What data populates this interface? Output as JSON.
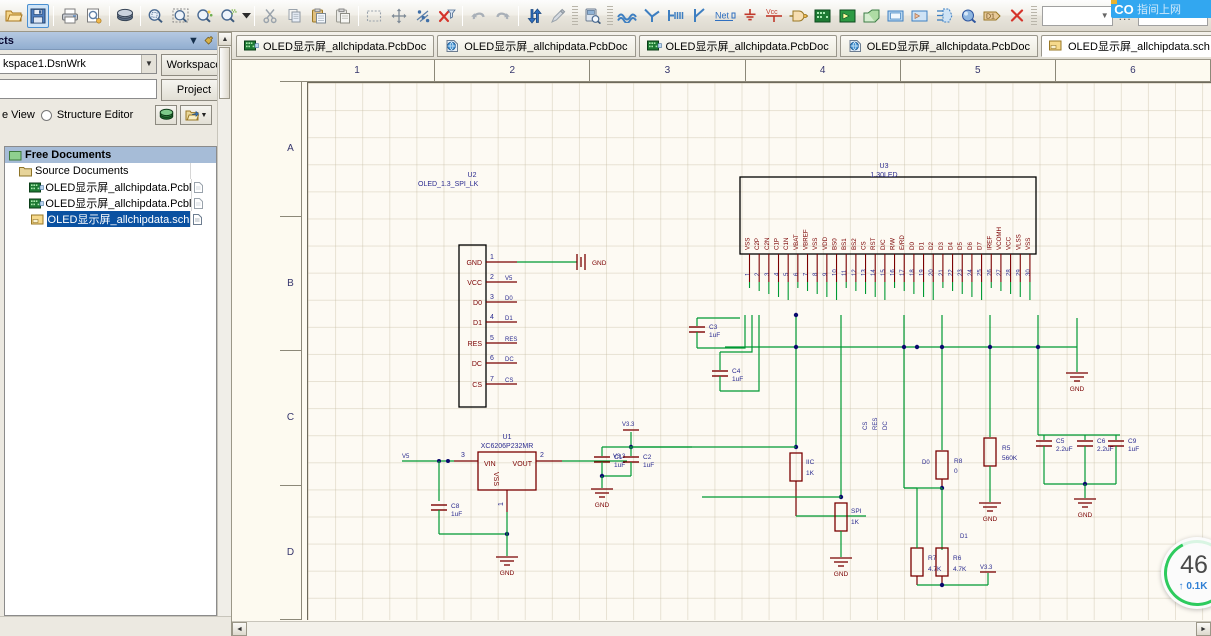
{
  "toolbar": {
    "buttons": [
      {
        "name": "open-icon",
        "label": "Open"
      },
      {
        "name": "save-icon",
        "label": "Save",
        "active": true
      },
      {
        "name": "print-icon",
        "label": "Print"
      },
      {
        "name": "print-preview-icon",
        "label": "Print Preview"
      },
      {
        "name": "board-insight-icon",
        "label": "Board Insight"
      },
      {
        "name": "zoom-area-icon",
        "label": "Zoom Area"
      },
      {
        "name": "zoom-selection-icon",
        "label": "Zoom Selection"
      },
      {
        "name": "zoom-filter-icon",
        "label": "Zoom Filter"
      },
      {
        "name": "zoom-mask-icon",
        "label": "Zoom Mask"
      },
      {
        "name": "cut-icon",
        "label": "Cut"
      },
      {
        "name": "copy-icon",
        "label": "Copy"
      },
      {
        "name": "paste-icon",
        "label": "Paste"
      },
      {
        "name": "paste-special-icon",
        "label": "Paste Special"
      },
      {
        "name": "select-area-icon",
        "label": "Select Area"
      },
      {
        "name": "move-icon",
        "label": "Move"
      },
      {
        "name": "deselect-icon",
        "label": "Deselect"
      },
      {
        "name": "clear-filter-icon",
        "label": "Clear Filter"
      },
      {
        "name": "undo-icon",
        "label": "Undo"
      },
      {
        "name": "redo-icon",
        "label": "Redo"
      },
      {
        "name": "updown-icon",
        "label": "Cross Probe"
      },
      {
        "name": "wand-icon",
        "label": "Smart Paste"
      },
      {
        "name": "browse-library-icon",
        "label": "Browse Library"
      },
      {
        "name": "place-wire-icon",
        "label": "Place Wire"
      },
      {
        "name": "place-bus-icon",
        "label": "Place Bus"
      },
      {
        "name": "place-signal-harness-icon",
        "label": "Place Signal Harness"
      },
      {
        "name": "place-bus-entry-icon",
        "label": "Place Bus Entry"
      },
      {
        "name": "place-net-label-icon",
        "label": "Place Net Label"
      },
      {
        "name": "place-gnd-icon",
        "label": "Place GND Power Port"
      },
      {
        "name": "place-vcc-icon",
        "label": "Place VCC Power Port"
      },
      {
        "name": "place-part-icon",
        "label": "Place Part"
      },
      {
        "name": "place-sheet-symbol-icon",
        "label": "Place Sheet Symbol"
      },
      {
        "name": "place-sheet-entry-icon",
        "label": "Place Sheet Entry"
      },
      {
        "name": "place-device-sheet-icon",
        "label": "Place Device Sheet Symbol"
      },
      {
        "name": "place-harness-connector-icon",
        "label": "Place Harness Connector"
      },
      {
        "name": "place-harness-entry-icon",
        "label": "Place Harness Entry"
      },
      {
        "name": "place-port-icon",
        "label": "Place Port"
      },
      {
        "name": "place-no-erc-icon",
        "label": "Place No ERC"
      }
    ],
    "combo1_value": "",
    "combo2_value": "",
    "ellipsis": "..."
  },
  "blue_overlay": {
    "badge": "CO",
    "text": "指间上网"
  },
  "projects_panel": {
    "title": "cts",
    "pin_icon": "pin-icon",
    "close_icon": "close-icon",
    "dropdown_icon": "chevron-down-icon",
    "workspace_value": "kspace1.DsnWrk",
    "workspace_button": "Workspace",
    "project_button": "Project",
    "project_value": "",
    "view_mode_label": "e View",
    "structure_editor_label": "Structure Editor",
    "globe_icon": "globe-icon",
    "open_doc_icon": "open-document-icon",
    "tree": [
      {
        "level": 0,
        "icon": "folder-green-icon",
        "label": "Free Documents",
        "selected_header": true,
        "page": ""
      },
      {
        "level": 1,
        "icon": "folder-icon",
        "label": "Source Documents",
        "page": ""
      },
      {
        "level": 2,
        "icon": "pcb-icon",
        "label": "OLED显示屏_allchipdata.Pcbl",
        "page": "doc-page-icon"
      },
      {
        "level": 2,
        "icon": "pcb-icon",
        "label": "OLED显示屏_allchipdata.Pcbl",
        "page": "doc-page-icon"
      },
      {
        "level": 2,
        "icon": "sch-icon",
        "label": "OLED显示屏_allchipdata.sch",
        "selected": true,
        "page": "doc-page-icon"
      }
    ]
  },
  "document_tabs": [
    {
      "icon": "pcb-icon",
      "label": "OLED显示屏_allchipdata.PcbDoc",
      "active": false
    },
    {
      "icon": "pcb3d-icon",
      "label": "OLED显示屏_allchipdata.PcbDoc",
      "active": false
    },
    {
      "icon": "pcb-icon",
      "label": "OLED显示屏_allchipdata.PcbDoc",
      "active": false
    },
    {
      "icon": "pcb3d-icon",
      "label": "OLED显示屏_allchipdata.PcbDoc",
      "active": false
    },
    {
      "icon": "sch-icon",
      "label": "OLED显示屏_allchipdata.sch",
      "active": true
    }
  ],
  "sheet": {
    "h_ruler": [
      "1",
      "2",
      "3",
      "4",
      "5",
      "6"
    ],
    "v_ruler": [
      "A",
      "B",
      "C",
      "D"
    ]
  },
  "schematic": {
    "components": [
      {
        "ref": "U2",
        "value": "OLED_1.3_SPI_LK",
        "pins": [
          {
            "num": "1",
            "name": "GND",
            "net": ""
          },
          {
            "num": "2",
            "name": "VCC",
            "net": "V5"
          },
          {
            "num": "3",
            "name": "D0",
            "net": "D0"
          },
          {
            "num": "4",
            "name": "D1",
            "net": "D1"
          },
          {
            "num": "5",
            "name": "RES",
            "net": "RES"
          },
          {
            "num": "6",
            "name": "DC",
            "net": "DC"
          },
          {
            "num": "7",
            "name": "CS",
            "net": "CS"
          }
        ],
        "gnd_label": "GND"
      },
      {
        "ref": "U3",
        "value": "1.30LED",
        "pin_names": [
          "VSS",
          "C2P",
          "C2N",
          "C1P",
          "C1N",
          "VBAT",
          "VBREF",
          "VSS",
          "VDD",
          "BS0",
          "BS1",
          "BS2",
          "CS",
          "RST",
          "D/C",
          "R/W",
          "E/RD",
          "D0",
          "D1",
          "D2",
          "D3",
          "D4",
          "D5",
          "D6",
          "D7",
          "IREF",
          "VCOMH",
          "VCC",
          "VLSS",
          "VSS"
        ],
        "pin_numbers": [
          "1",
          "2",
          "3",
          "4",
          "5",
          "6",
          "7",
          "8",
          "9",
          "10",
          "11",
          "12",
          "13",
          "14",
          "15",
          "16",
          "17",
          "18",
          "19",
          "20",
          "21",
          "22",
          "23",
          "24",
          "25",
          "26",
          "27",
          "28",
          "29",
          "30"
        ]
      },
      {
        "ref": "U1",
        "value": "XC6206P232MR",
        "pins": [
          {
            "num": "3",
            "name": "VIN"
          },
          {
            "num": "2",
            "name": "VOUT"
          },
          {
            "num": "1",
            "name": "VSS"
          }
        ]
      }
    ],
    "passives": [
      {
        "ref": "C1",
        "value": "1uF"
      },
      {
        "ref": "C2",
        "value": "1uF"
      },
      {
        "ref": "C3",
        "value": "1uF"
      },
      {
        "ref": "C4",
        "value": "1uF"
      },
      {
        "ref": "C5",
        "value": "2.2uF"
      },
      {
        "ref": "C6",
        "value": "2.2uF"
      },
      {
        "ref": "C9",
        "value": "1uF"
      },
      {
        "ref": "C8",
        "value": "1uF"
      },
      {
        "ref": "IIC",
        "value": "1K"
      },
      {
        "ref": "SPI",
        "value": "1K"
      },
      {
        "ref": "R5",
        "value": "560K"
      },
      {
        "ref": "R6",
        "value": "4.7K"
      },
      {
        "ref": "R7",
        "value": "4.7K"
      },
      {
        "ref": "R8",
        "value": "0"
      }
    ],
    "net_labels": [
      "V5",
      "V3.3",
      "V3.3",
      "V3.3",
      "D0",
      "D1",
      "D0",
      "D1",
      "CS",
      "RES",
      "DC"
    ],
    "power_ports": [
      "GND",
      "GND",
      "GND",
      "GND",
      "GND",
      "GND"
    ],
    "colors": {
      "wire": "#009933",
      "pin": "#7a0000",
      "label": "#2b2b8f",
      "body_outline": "#7a0000",
      "u3_outline": "#000000",
      "sheet_bg": "#fdfaf3"
    }
  },
  "net_widget": {
    "value": "46",
    "sub": "↑ 0.1K"
  }
}
